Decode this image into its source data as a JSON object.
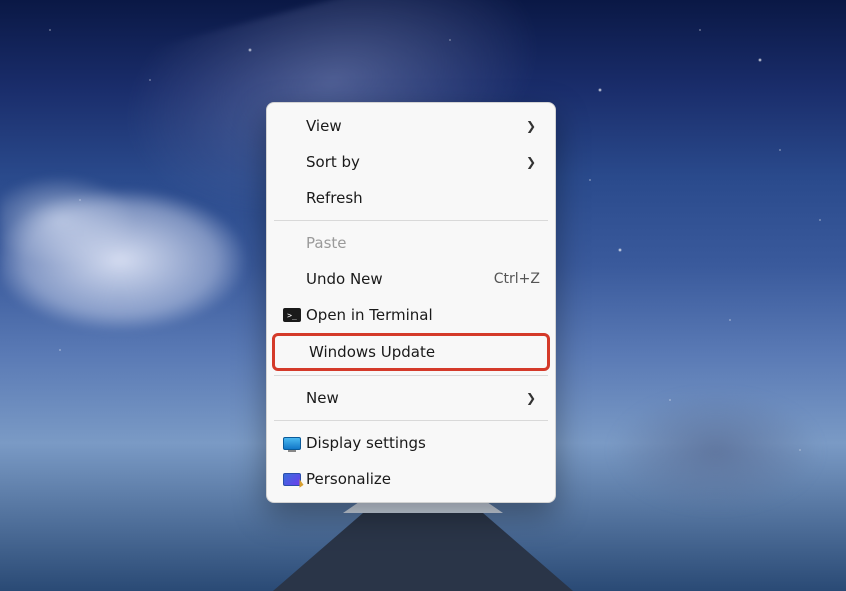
{
  "menu": {
    "view": "View",
    "sort_by": "Sort by",
    "refresh": "Refresh",
    "paste": "Paste",
    "undo_new": "Undo New",
    "undo_new_accel": "Ctrl+Z",
    "open_terminal": "Open in Terminal",
    "windows_update": "Windows Update",
    "new": "New",
    "display_settings": "Display settings",
    "personalize": "Personalize"
  }
}
